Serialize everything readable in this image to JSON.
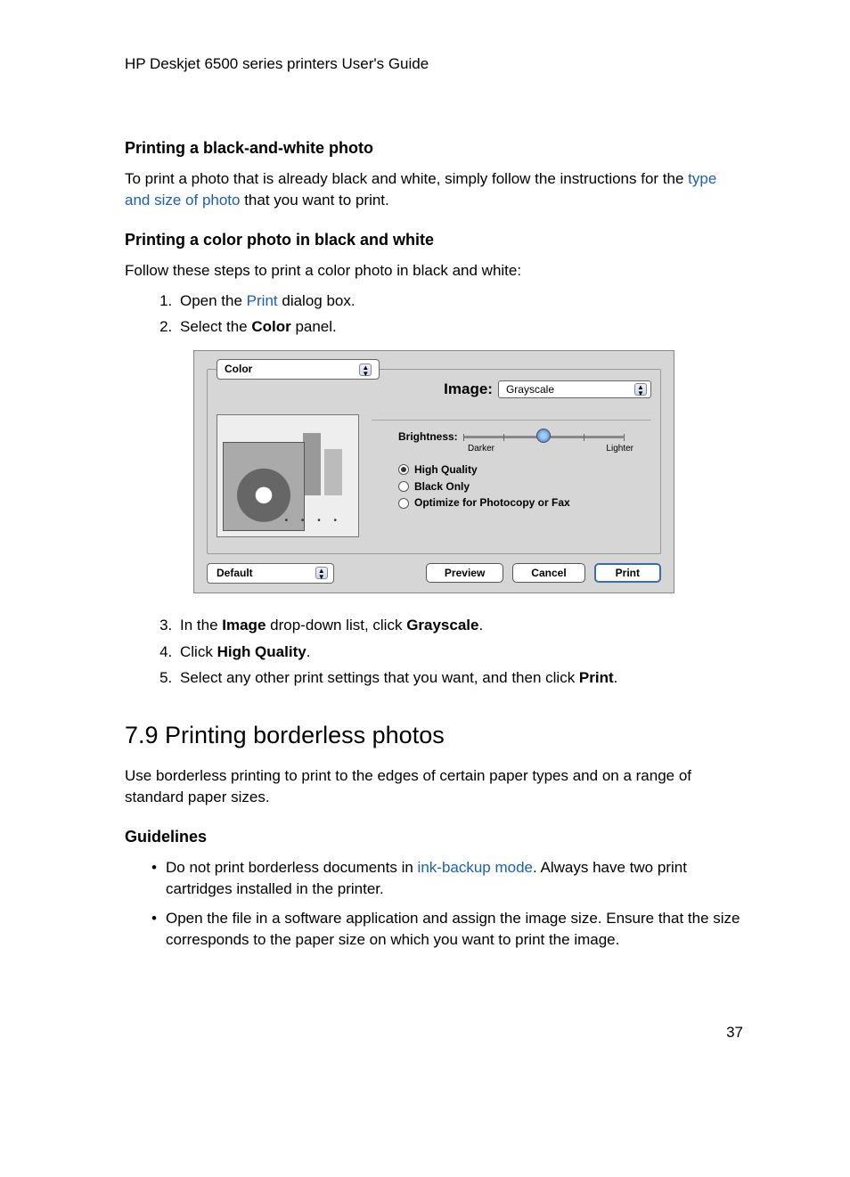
{
  "header": {
    "title": "HP Deskjet 6500 series printers User's Guide"
  },
  "section1": {
    "heading": "Printing a black-and-white photo",
    "para_pre": "To print a photo that is already black and white, simply follow the instructions for the ",
    "link": "type and size of photo",
    "para_post": " that you want to print."
  },
  "section2": {
    "heading": "Printing a color photo in black and white",
    "intro": "Follow these steps to print a color photo in black and white:",
    "step1_pre": "Open the ",
    "step1_link": "Print",
    "step1_post": " dialog box.",
    "step2_pre": "Select the ",
    "step2_bold": "Color",
    "step2_post": " panel.",
    "step3_pre": "In the ",
    "step3_bold1": "Image",
    "step3_mid": " drop-down list, click ",
    "step3_bold2": "Grayscale",
    "step3_post": ".",
    "step4_pre": "Click ",
    "step4_bold": "High Quality",
    "step4_post": ".",
    "step5_pre": "Select any other print settings that you want, and then click ",
    "step5_bold": "Print",
    "step5_post": "."
  },
  "dialog": {
    "panel_dropdown": "Color",
    "image_label": "Image:",
    "image_value": "Grayscale",
    "brightness_label": "Brightness:",
    "brightness_left": "Darker",
    "brightness_right": "Lighter",
    "radio_high_quality": "High Quality",
    "radio_black_only": "Black Only",
    "radio_optimize": "Optimize for Photocopy or Fax",
    "preset": "Default",
    "btn_preview": "Preview",
    "btn_cancel": "Cancel",
    "btn_print": "Print"
  },
  "section3": {
    "title": "7.9  Printing borderless photos",
    "intro": "Use borderless printing to print to the edges of certain paper types and on a range of standard paper sizes.",
    "guidelines_heading": "Guidelines",
    "g1_pre": "Do not print borderless documents in ",
    "g1_link": "ink-backup mode",
    "g1_post": ". Always have two print cartridges installed in the printer.",
    "g2": "Open the file in a software application and assign the image size. Ensure that the size corresponds to the paper size on which you want to print the image."
  },
  "page_number": "37"
}
